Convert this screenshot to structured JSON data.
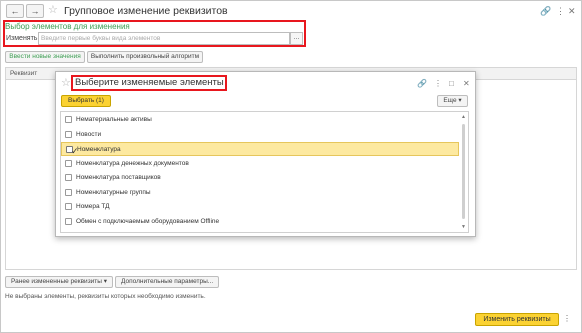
{
  "window": {
    "title": "Групповое изменение реквизитов",
    "back_icon": "arrow-left",
    "forward_icon": "arrow-right"
  },
  "selection": {
    "group_title": "Выбор элементов для изменения",
    "change_label": "Изменять:",
    "change_placeholder": "Введите первые буквы вида элементов",
    "dots_label": "..."
  },
  "toolbar": {
    "enter_new_values": "Ввести новые значения",
    "run_custom_algorithm": "Выполнить произвольный алгоритм"
  },
  "grid": {
    "column_header": "Реквизит"
  },
  "bottom": {
    "previously_changed": "Ранее измененные реквизиты",
    "additional_params": "Дополнительные параметры...",
    "status": "Не выбраны элементы, реквизиты которых необходимо изменить.",
    "apply": "Изменить реквизиты",
    "more": "⋮"
  },
  "dialog": {
    "title": "Выберите изменяемые элементы",
    "choose_button": "Выбрать (1)",
    "more_button": "Еще",
    "items": [
      {
        "label": "Нематериальные активы",
        "checked": false
      },
      {
        "label": "Новости",
        "checked": false
      },
      {
        "label": "Номенклатура",
        "checked": true
      },
      {
        "label": "Номенклатура денежных документов",
        "checked": false
      },
      {
        "label": "Номенклатура поставщиков",
        "checked": false
      },
      {
        "label": "Номенклатурные группы",
        "checked": false
      },
      {
        "label": "Номера ТД",
        "checked": false
      },
      {
        "label": "Обмен с подключаемым оборудованием Offline",
        "checked": false
      }
    ]
  },
  "colors": {
    "accent_yellow": "#fbd233",
    "highlight_red": "#e8171e",
    "title_green": "#3d9e53",
    "selected_row": "#fde9a0"
  }
}
